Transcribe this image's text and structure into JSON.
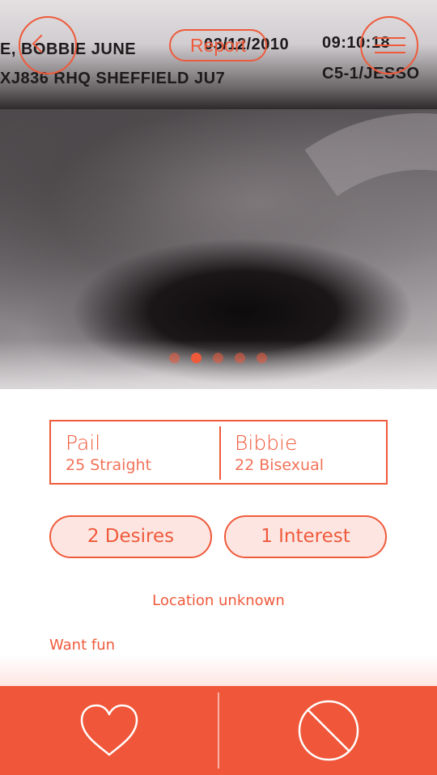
{
  "photo": {
    "overlay_lines": [
      "E, BOBBIE JUNE",
      "03/12/2010",
      "09:10:18",
      "XJ836  RHQ SHEFFIELD JU7",
      "C5-1/JESSO"
    ]
  },
  "header": {
    "back_icon": "chevron-left-icon",
    "report_label": "Report",
    "menu_icon": "hamburger-menu-icon"
  },
  "carousel": {
    "dot_count": 5,
    "active_index": 1
  },
  "profile": {
    "people": [
      {
        "name": "Pail",
        "info": "25 Straight"
      },
      {
        "name": "Bibbie",
        "info": "22 Bisexual"
      }
    ],
    "desires_label": "2 Desires",
    "interest_label": "1 Interest",
    "location": "Location unknown",
    "bio": "Want fun"
  },
  "actions": {
    "like_icon": "heart-icon",
    "pass_icon": "block-icon"
  },
  "colors": {
    "accent": "#f0573a",
    "pill_bg": "#fde6e2"
  }
}
